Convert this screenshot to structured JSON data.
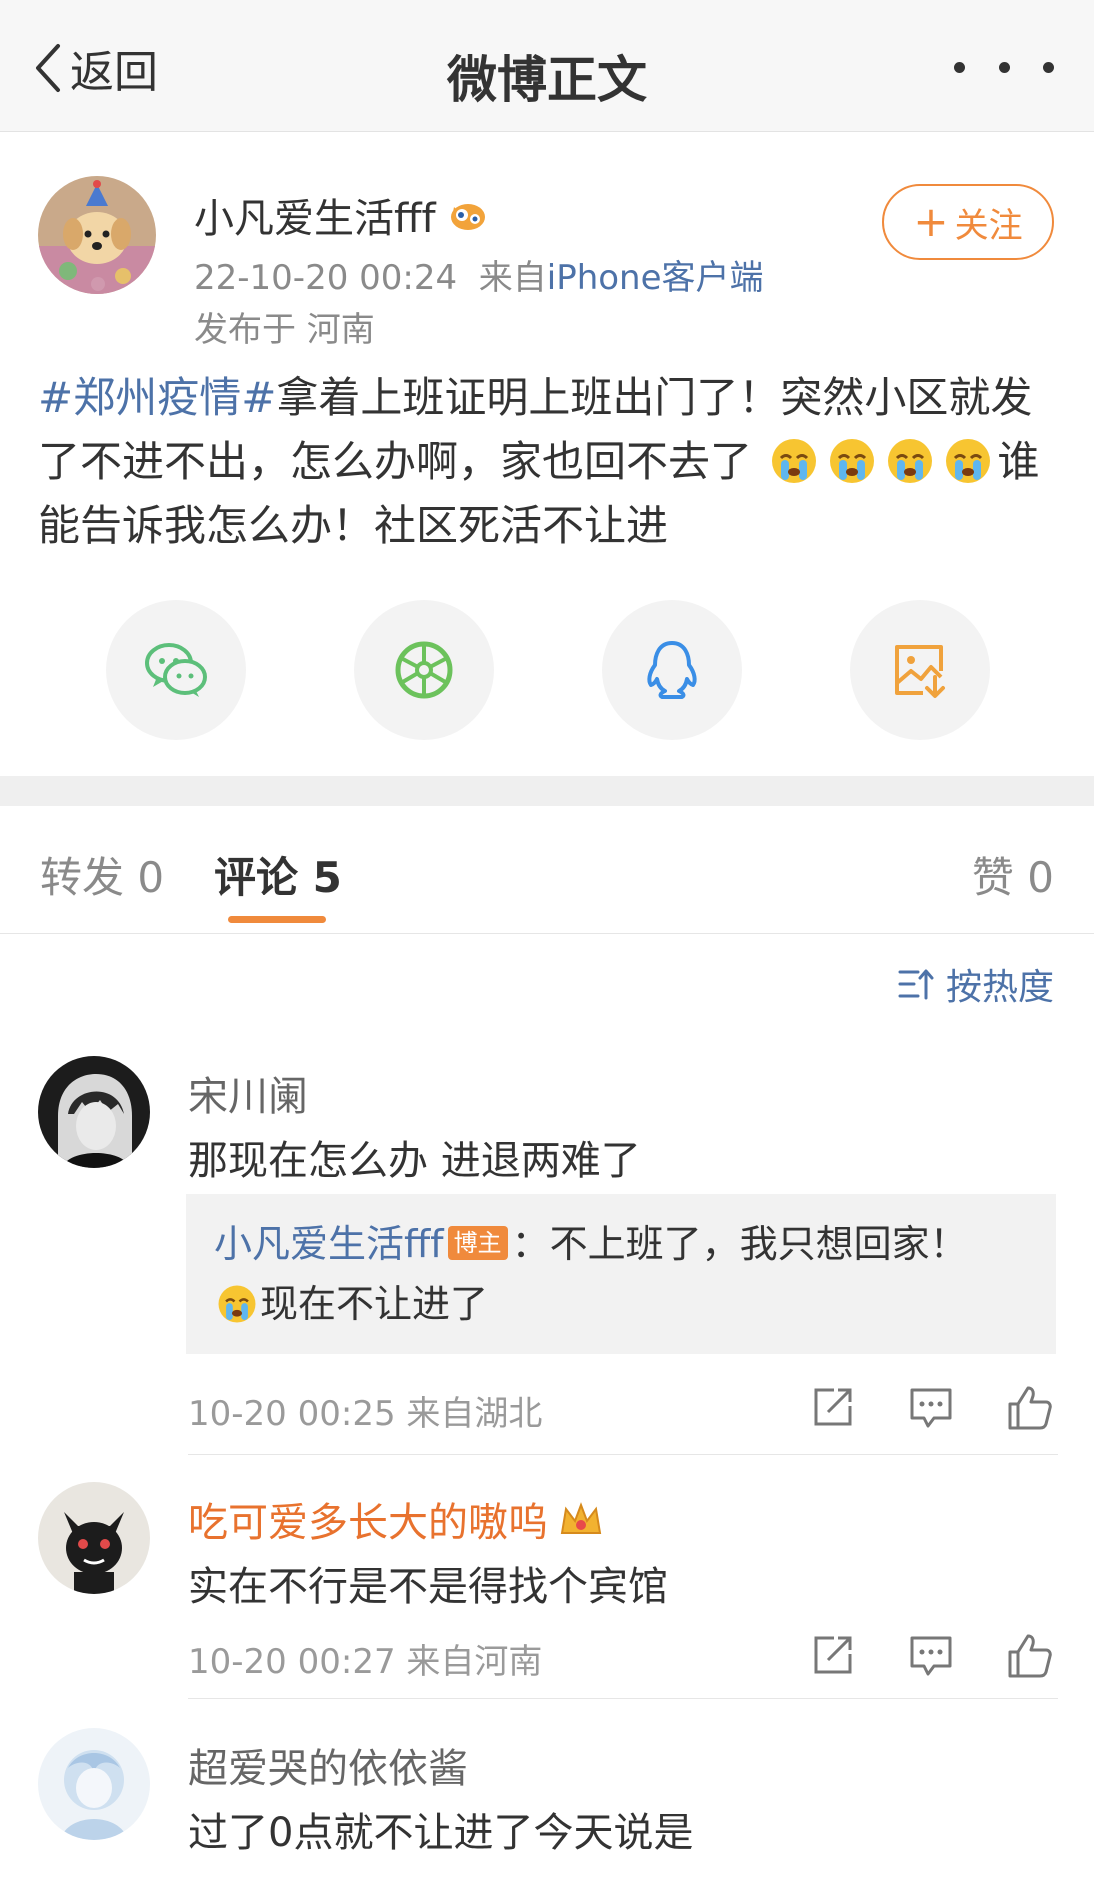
{
  "header": {
    "back_label": "返回",
    "title": "微博正文"
  },
  "post": {
    "author": "小凡爱生活fff",
    "time": "22-10-20 00:24",
    "from_prefix": "来自",
    "source": "iPhone客户端",
    "location": "发布于 河南",
    "follow_label": "关注",
    "hashtag": "#郑州疫情#",
    "text_part1": "拿着上班证明上班出门了！突然小区就发了不进不出，怎么办啊，家也回不去了",
    "text_part2": "谁能告诉我怎么办！社区死活不让进",
    "emoji_name": "crying-emoji"
  },
  "share": {
    "items": [
      "wechat-icon",
      "moments-icon",
      "qq-icon",
      "save-image-icon"
    ],
    "colors": {
      "wechat": "#5cbf7a",
      "moments": "#6cc25c",
      "qq": "#3a8ee6",
      "save": "#f0a23c"
    }
  },
  "tabs": {
    "repost": "转发 0",
    "comments": "评论 5",
    "likes": "赞 0"
  },
  "sort_label": "按热度",
  "colors": {
    "accent": "#f08a3c",
    "link": "#4d72a8"
  },
  "comments": [
    {
      "name": "宋川阑",
      "text": "那现在怎么办 进退两难了",
      "reply": {
        "name": "小凡爱生活fff",
        "badge": "博主",
        "text_a": "：不上班了，我只想回家！",
        "text_b": "现在不让进了"
      },
      "meta": "10-20 00:25  来自湖北"
    },
    {
      "name": "吃可爱多长大的嗷呜",
      "text": "实在不行是不是得找个宾馆",
      "meta": "10-20 00:27  来自河南"
    },
    {
      "name": "超爱哭的依依酱",
      "text": "过了0点就不让进了今天说是"
    }
  ]
}
